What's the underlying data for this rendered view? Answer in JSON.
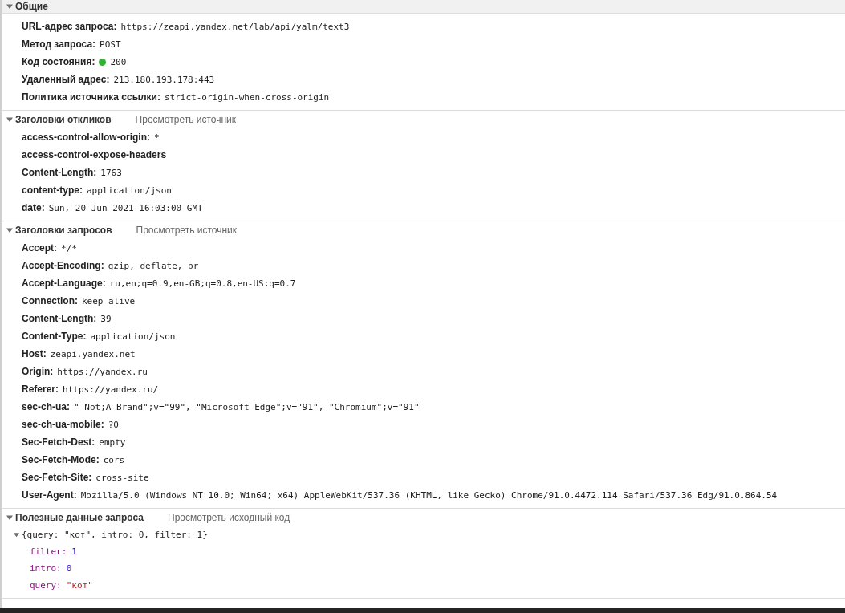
{
  "sections": [
    {
      "title": "Общие",
      "expanded": true,
      "rows": [
        {
          "name": "URL-адрес запроса:",
          "value": "https://zeapi.yandex.net/lab/api/yalm/text3"
        },
        {
          "name": "Метод запроса:",
          "value": "POST"
        },
        {
          "name": "Код состояния:",
          "value": "200",
          "color": "#2db52d"
        },
        {
          "name": "Удаленный адрес:",
          "value": "213.180.193.178:443"
        },
        {
          "name": "Политика источника ссылки:",
          "value": "strict-origin-when-cross-origin"
        }
      ]
    },
    {
      "title": "Заголовки откликов",
      "expanded": true,
      "link": "Просмотреть источник",
      "rows": [
        {
          "name": "access-control-allow-origin:",
          "value": "*"
        },
        {
          "name": "access-control-expose-headers"
        },
        {
          "name": "Content-Length:",
          "value": "1763"
        },
        {
          "name": "content-type:",
          "value": "application/json"
        },
        {
          "name": "date:",
          "value": "Sun, 20 Jun 2021 16:03:00 GMT"
        }
      ]
    },
    {
      "title": "Заголовки запросов",
      "expanded": true,
      "link": "Просмотреть источник",
      "rows": [
        {
          "name": "Accept:",
          "value": "*/*"
        },
        {
          "name": "Accept-Encoding:",
          "value": "gzip, deflate, br"
        },
        {
          "name": "Accept-Language:",
          "value": "ru,en;q=0.9,en-GB;q=0.8,en-US;q=0.7"
        },
        {
          "name": "Connection:",
          "value": "keep-alive"
        },
        {
          "name": "Content-Length:",
          "value": "39"
        },
        {
          "name": "Content-Type:",
          "value": "application/json"
        },
        {
          "name": "Host:",
          "value": "zeapi.yandex.net"
        },
        {
          "name": "Origin:",
          "value": "https://yandex.ru"
        },
        {
          "name": "Referer:",
          "value": "https://yandex.ru/"
        },
        {
          "name": "sec-ch-ua:",
          "value": "\" Not;A Brand\";v=\"99\", \"Microsoft Edge\";v=\"91\", \"Chromium\";v=\"91\""
        },
        {
          "name": "sec-ch-ua-mobile:",
          "value": "?0"
        },
        {
          "name": "Sec-Fetch-Dest:",
          "value": "empty"
        },
        {
          "name": "Sec-Fetch-Mode:",
          "value": "cors"
        },
        {
          "name": "Sec-Fetch-Site:",
          "value": "cross-site"
        },
        {
          "name": "User-Agent:",
          "value": "Mozilla/5.0 (Windows NT 10.0; Win64; x64) AppleWebKit/537.36 (KHTML, like Gecko) Chrome/91.0.4472.114 Safari/537.36 Edg/91.0.864.54"
        }
      ]
    },
    {
      "title": "Полезные данные запроса",
      "expanded": true,
      "link": "Просмотреть исходный код",
      "payload": {
        "summary": "{query: \"кот\", intro: 0, filter: 1}",
        "expanded": true,
        "children": [
          {
            "key": "filter:",
            "value": "1",
            "kind": "number"
          },
          {
            "key": "intro:",
            "value": "0",
            "kind": "number"
          },
          {
            "key": "query:",
            "value": "\"кот\"",
            "kind": "string"
          }
        ]
      }
    }
  ]
}
